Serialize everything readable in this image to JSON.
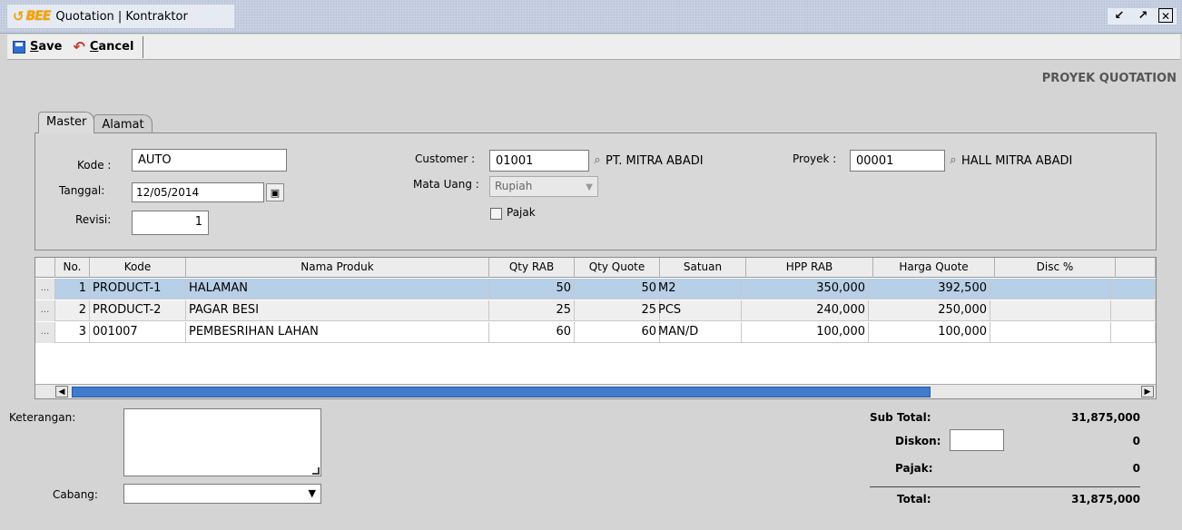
{
  "window": {
    "logo_text": "BEE",
    "title": "Quotation | Kontraktor",
    "controls": {
      "minimize": "↙",
      "maximize": "↗",
      "close": "✕"
    }
  },
  "toolbar": {
    "save_prefix": "S",
    "save_rest": "ave",
    "cancel_prefix": "C",
    "cancel_rest": "ancel"
  },
  "header_label": "PROYEK QUOTATION",
  "tabs": [
    {
      "label": "Master",
      "active": true
    },
    {
      "label": "Alamat",
      "active": false
    }
  ],
  "form": {
    "kode_label": "Kode :",
    "kode_value": "AUTO",
    "tanggal_label": "Tanggal:",
    "tanggal_value": "12/05/2014",
    "revisi_label": "Revisi:",
    "revisi_value": "1",
    "customer_label": "Customer :",
    "customer_code": "01001",
    "customer_name": "PT. MITRA ABADI",
    "mata_uang_label": "Mata Uang :",
    "mata_uang_value": "Rupiah",
    "pajak_label": "Pajak",
    "proyek_label": "Proyek :",
    "proyek_code": "00001",
    "proyek_name": "HALL MITRA ABADI"
  },
  "grid": {
    "columns": [
      "",
      "No.",
      "Kode",
      "Nama Produk",
      "Qty RAB",
      "Qty Quote",
      "Satuan",
      "HPP RAB",
      "Harga Quote",
      "Disc %",
      ""
    ],
    "rows": [
      {
        "ind": "...",
        "no": "1",
        "kode": "PRODUCT-1",
        "nama": "HALAMAN",
        "qty_rab": "50",
        "qty_quote": "50",
        "satuan": "M2",
        "hpp_rab": "350,000",
        "harga_quote": "392,500",
        "disc": ""
      },
      {
        "ind": "...",
        "no": "2",
        "kode": "PRODUCT-2",
        "nama": "PAGAR BESI",
        "qty_rab": "25",
        "qty_quote": "25",
        "satuan": "PCS",
        "hpp_rab": "240,000",
        "harga_quote": "250,000",
        "disc": ""
      },
      {
        "ind": "...",
        "no": "3",
        "kode": "001007",
        "nama": "PEMBESRIHAN LAHAN",
        "qty_rab": "60",
        "qty_quote": "60",
        "satuan": "MAN/D",
        "hpp_rab": "100,000",
        "harga_quote": "100,000",
        "disc": ""
      }
    ]
  },
  "bottom": {
    "keterangan_label": "Keterangan:",
    "cabang_label": "Cabang:",
    "sub_total_label": "Sub Total:",
    "sub_total_value": "31,875,000",
    "diskon_label": "Diskon:",
    "diskon_value": "0",
    "pajak_label": "Pajak:",
    "pajak_value": "0",
    "total_label": "Total:",
    "total_value": "31,875,000"
  }
}
